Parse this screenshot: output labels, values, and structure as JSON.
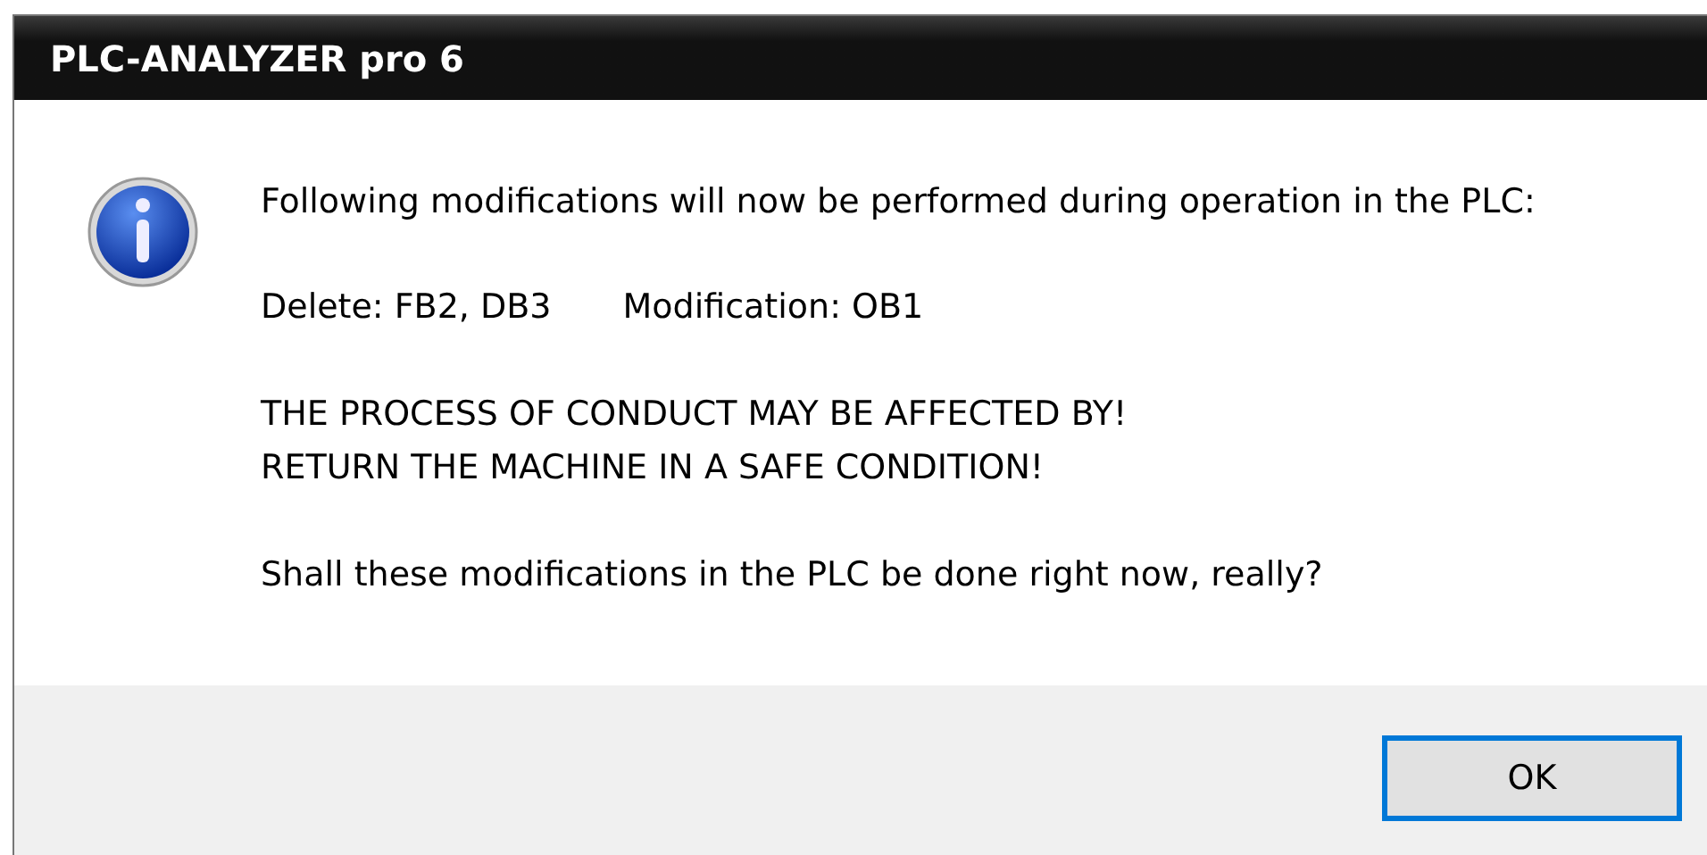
{
  "window": {
    "title": "PLC-ANALYZER pro 6"
  },
  "message": {
    "intro": "Following modifications will now be performed during operation in the PLC:",
    "details": [
      "Delete: FB2, DB3",
      "Modification: OB1"
    ],
    "warnings": [
      "THE PROCESS OF CONDUCT MAY BE AFFECTED BY!",
      "RETURN THE MACHINE IN A SAFE CONDITION!"
    ],
    "question": "Shall these modifications in the PLC be done right now, really?"
  },
  "buttons": [
    {
      "label": "OK",
      "selected": true
    }
  ]
}
